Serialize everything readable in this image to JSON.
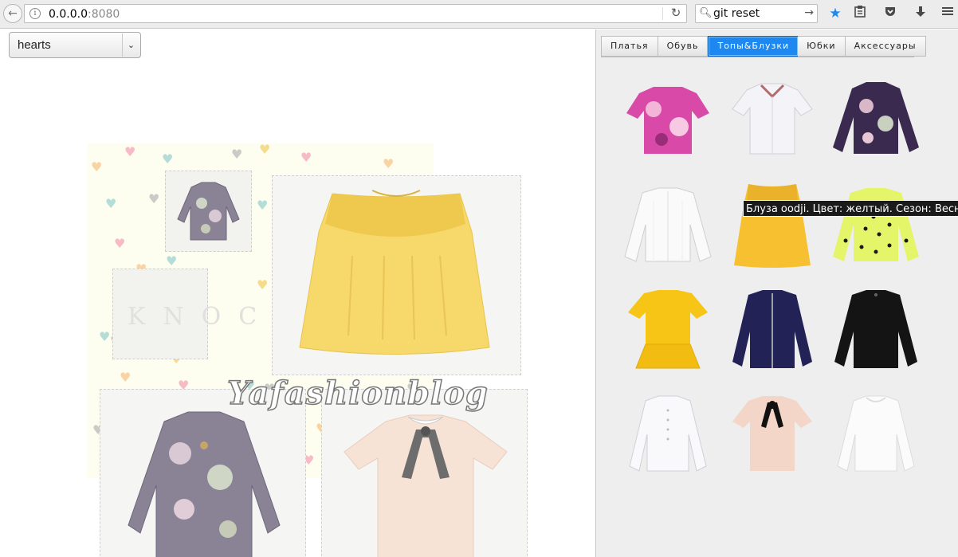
{
  "browser": {
    "url_host": "0.0.0.0",
    "url_port": ":8080",
    "search_query": "git reset",
    "bookmark_color": "#1e88f0"
  },
  "canvas": {
    "theme_select": {
      "value": "hearts"
    },
    "watermark": "KNOCKNOCK",
    "logo_text": "Yafashionblog",
    "heart_colors": [
      "#f4a6b8",
      "#f7c58a",
      "#9ed3d0",
      "#b9b9b9",
      "#f2d26b"
    ]
  },
  "panel": {
    "tabs": [
      {
        "label": "Платья",
        "active": false
      },
      {
        "label": "Обувь",
        "active": false
      },
      {
        "label": "Топы&Блузки",
        "active": true
      },
      {
        "label": "Юбки",
        "active": false
      },
      {
        "label": "Аксессуары",
        "active": false
      }
    ],
    "tooltip": "Блуза oodji. Цвет: желтый. Сезон: Весна"
  },
  "icons": {
    "back": "back-arrow-icon",
    "info": "info-icon",
    "reload": "reload-icon",
    "search": "search-icon",
    "bookmark": "star-icon",
    "reader": "clipboard-icon",
    "pocket": "pocket-icon",
    "download": "download-icon",
    "menu": "hamburger-menu-icon"
  }
}
